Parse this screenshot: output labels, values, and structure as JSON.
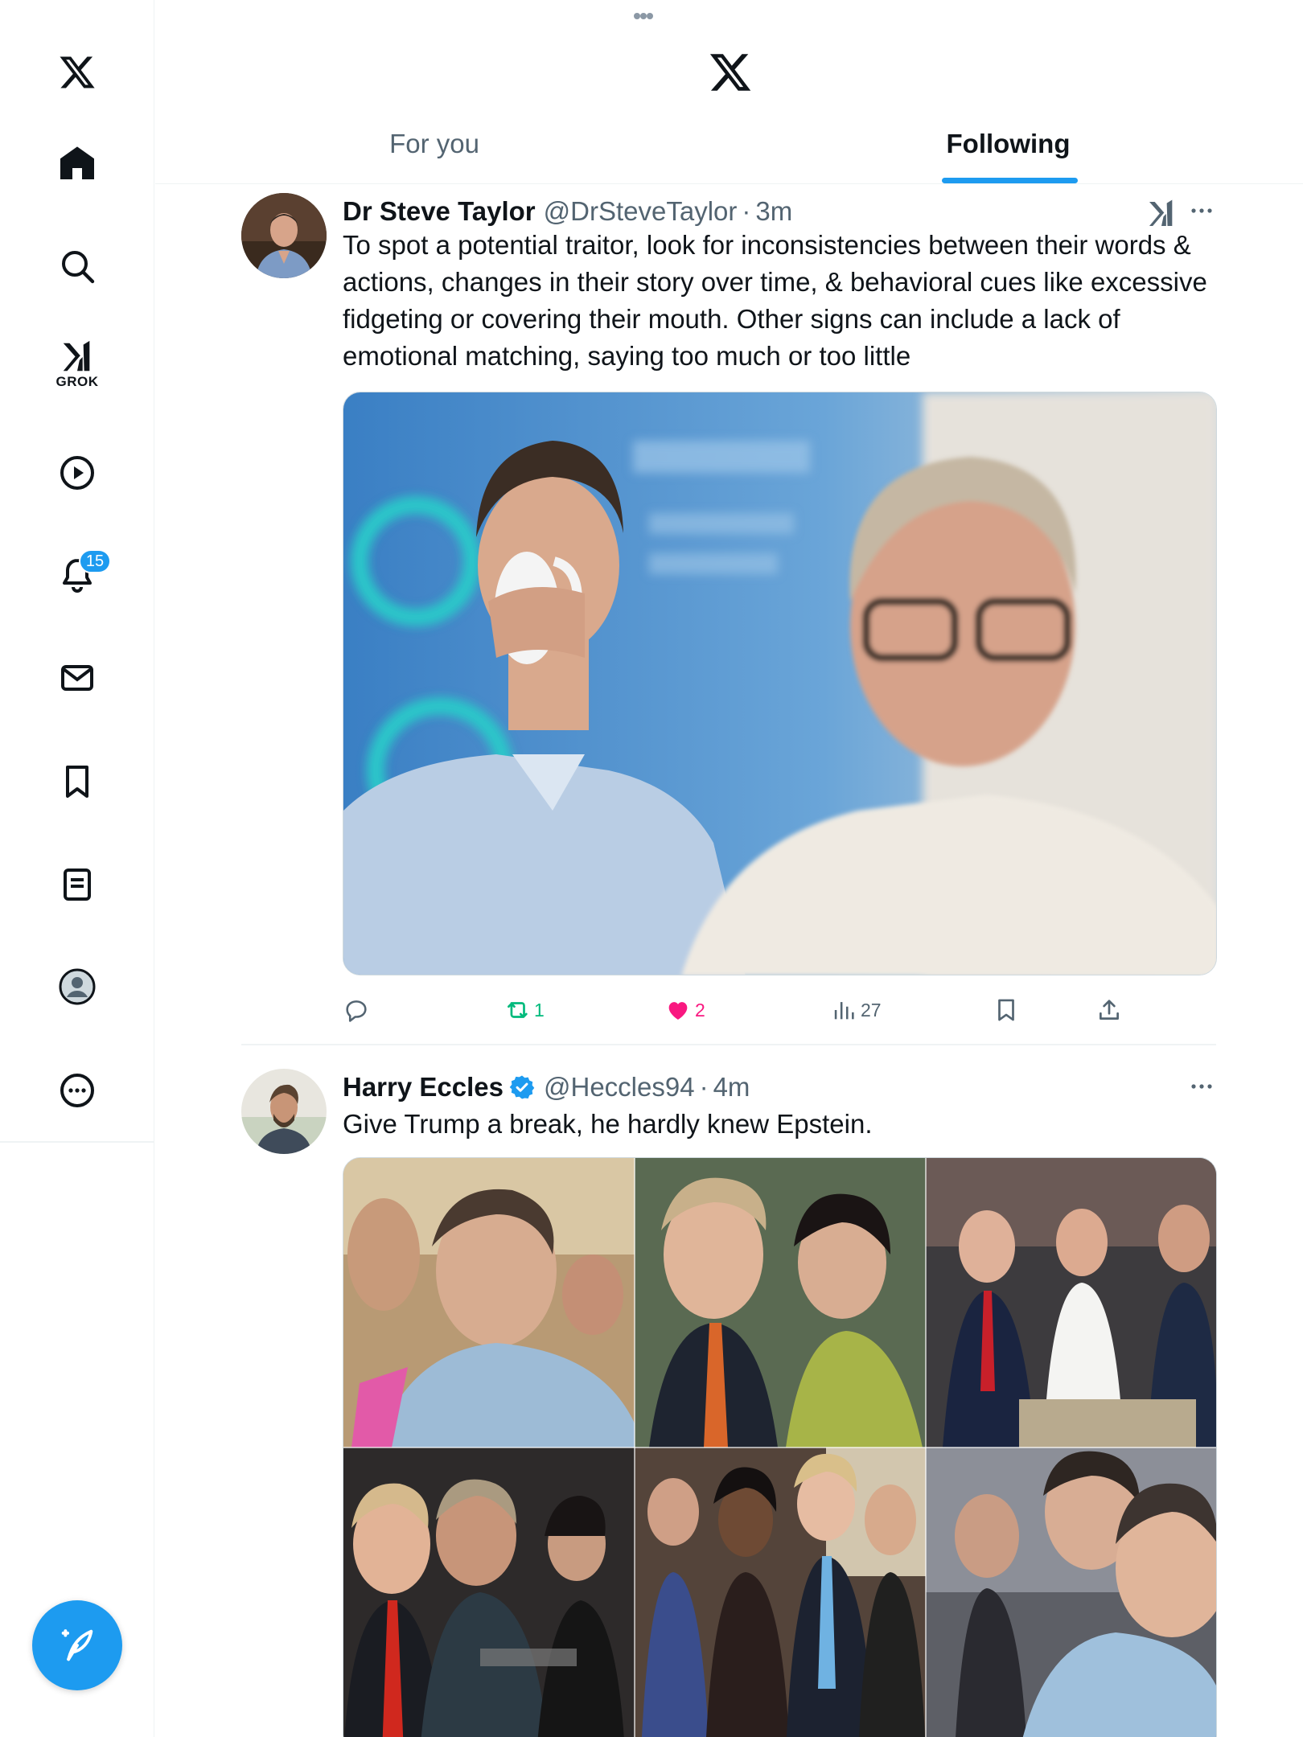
{
  "sidebar": {
    "icons": [
      "x-logo-icon",
      "home-icon",
      "search-icon",
      "grok-icon",
      "video-icon",
      "notifications-icon",
      "messages-icon",
      "bookmarks-icon",
      "lists-icon",
      "profile-icon",
      "more-icon"
    ],
    "grok_label": "GROK",
    "notifications_badge": "15",
    "compose_icon": "compose-icon"
  },
  "header": {
    "tabs": [
      {
        "label": "For you",
        "active": false
      },
      {
        "label": "Following",
        "active": true
      }
    ],
    "accent_color": "#1d9bf0"
  },
  "tweets": [
    {
      "name": "Dr Steve Taylor",
      "handle": "@DrSteveTaylor",
      "separator": "·",
      "time": "3m",
      "text": "To spot a potential traitor, look for inconsistencies between their words & actions, changes in their story over time, & behavioral cues like excessive fidgeting or covering their mouth. Other signs can include a lack of emotional matching, saying too much or too little",
      "actions": {
        "replies": "",
        "reposts": "1",
        "likes": "2",
        "views": "27"
      }
    },
    {
      "name": "Harry Eccles",
      "verified": true,
      "handle": "@Heccles94",
      "separator": "·",
      "time": "4m",
      "text": "Give Trump a break, he hardly knew Epstein."
    }
  ],
  "colors": {
    "like": "#f91880",
    "repost": "#00ba7c",
    "muted": "#536471"
  }
}
